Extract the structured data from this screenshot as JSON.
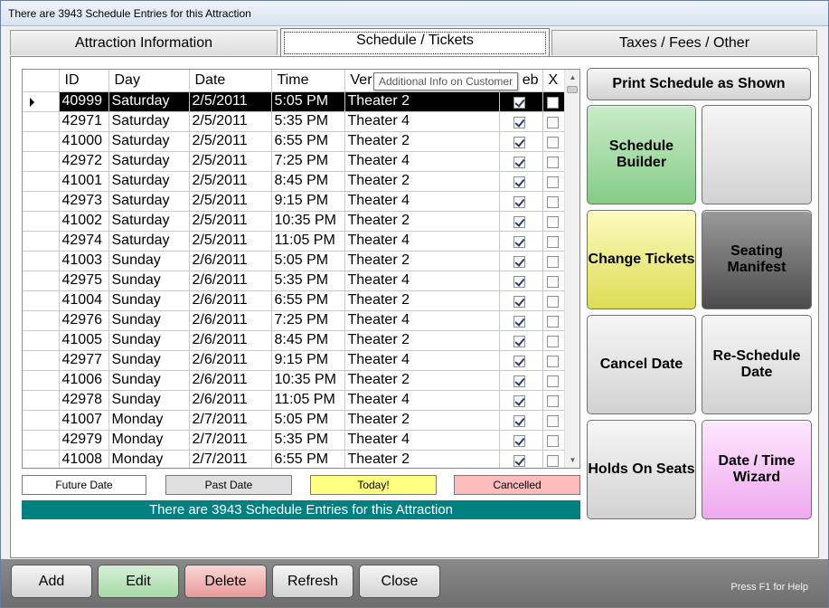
{
  "window": {
    "title": "There are 3943 Schedule Entries for this Attraction"
  },
  "tabs": [
    {
      "label": "Attraction Information"
    },
    {
      "label": "Schedule / Tickets"
    },
    {
      "label": "Taxes / Fees / Other"
    }
  ],
  "grid": {
    "columns": [
      "ID",
      "Day",
      "Date",
      "Time",
      "Ver",
      "eb",
      "X"
    ],
    "rows": [
      {
        "id": "40999",
        "day": "Saturday",
        "date": "2/5/2011",
        "time": "5:05 PM",
        "venue": "Theater 2",
        "web": true,
        "x": false
      },
      {
        "id": "42971",
        "day": "Saturday",
        "date": "2/5/2011",
        "time": "5:35 PM",
        "venue": "Theater 4",
        "web": true,
        "x": false
      },
      {
        "id": "41000",
        "day": "Saturday",
        "date": "2/5/2011",
        "time": "6:55 PM",
        "venue": "Theater 2",
        "web": true,
        "x": false
      },
      {
        "id": "42972",
        "day": "Saturday",
        "date": "2/5/2011",
        "time": "7:25 PM",
        "venue": "Theater 4",
        "web": true,
        "x": false
      },
      {
        "id": "41001",
        "day": "Saturday",
        "date": "2/5/2011",
        "time": "8:45 PM",
        "venue": "Theater 2",
        "web": true,
        "x": false
      },
      {
        "id": "42973",
        "day": "Saturday",
        "date": "2/5/2011",
        "time": "9:15 PM",
        "venue": "Theater 4",
        "web": true,
        "x": false
      },
      {
        "id": "41002",
        "day": "Saturday",
        "date": "2/5/2011",
        "time": "10:35 PM",
        "venue": "Theater 2",
        "web": true,
        "x": false
      },
      {
        "id": "42974",
        "day": "Saturday",
        "date": "2/5/2011",
        "time": "11:05 PM",
        "venue": "Theater 4",
        "web": true,
        "x": false
      },
      {
        "id": "41003",
        "day": "Sunday",
        "date": "2/6/2011",
        "time": "5:05 PM",
        "venue": "Theater 2",
        "web": true,
        "x": false
      },
      {
        "id": "42975",
        "day": "Sunday",
        "date": "2/6/2011",
        "time": "5:35 PM",
        "venue": "Theater 4",
        "web": true,
        "x": false
      },
      {
        "id": "41004",
        "day": "Sunday",
        "date": "2/6/2011",
        "time": "6:55 PM",
        "venue": "Theater 2",
        "web": true,
        "x": false
      },
      {
        "id": "42976",
        "day": "Sunday",
        "date": "2/6/2011",
        "time": "7:25 PM",
        "venue": "Theater 4",
        "web": true,
        "x": false
      },
      {
        "id": "41005",
        "day": "Sunday",
        "date": "2/6/2011",
        "time": "8:45 PM",
        "venue": "Theater 2",
        "web": true,
        "x": false
      },
      {
        "id": "42977",
        "day": "Sunday",
        "date": "2/6/2011",
        "time": "9:15 PM",
        "venue": "Theater 4",
        "web": true,
        "x": false
      },
      {
        "id": "41006",
        "day": "Sunday",
        "date": "2/6/2011",
        "time": "10:35 PM",
        "venue": "Theater 2",
        "web": true,
        "x": false
      },
      {
        "id": "42978",
        "day": "Sunday",
        "date": "2/6/2011",
        "time": "11:05 PM",
        "venue": "Theater 4",
        "web": true,
        "x": false
      },
      {
        "id": "41007",
        "day": "Monday",
        "date": "2/7/2011",
        "time": "5:05 PM",
        "venue": "Theater 2",
        "web": true,
        "x": false
      },
      {
        "id": "42979",
        "day": "Monday",
        "date": "2/7/2011",
        "time": "5:35 PM",
        "venue": "Theater 4",
        "web": true,
        "x": false
      },
      {
        "id": "41008",
        "day": "Monday",
        "date": "2/7/2011",
        "time": "6:55 PM",
        "venue": "Theater 2",
        "web": true,
        "x": false
      }
    ],
    "tooltip": "Additional Info on Customer"
  },
  "legend": {
    "future": "Future Date",
    "past": "Past Date",
    "today": "Today!",
    "cancelled": "Cancelled"
  },
  "status": "There are 3943 Schedule Entries for this Attraction",
  "actions": {
    "print": "Print Schedule as Shown",
    "schedule_builder": "Schedule Builder",
    "change_tickets": "Change Tickets",
    "seating_manifest": "Seating Manifest",
    "cancel_date": "Cancel Date",
    "reschedule_date": "Re-Schedule Date",
    "holds_on_seats": "Holds On Seats",
    "date_time_wizard": "Date / Time Wizard"
  },
  "bottom": {
    "add": "Add",
    "edit": "Edit",
    "delete": "Delete",
    "refresh": "Refresh",
    "close": "Close",
    "help": "Press F1 for Help"
  },
  "colors": {
    "status_bar": "#008080",
    "today": "#ffff80",
    "cancelled": "#ffbcbc",
    "past": "#e0e0e0"
  },
  "icons": [
    "row-pointer-icon",
    "checkbox-icon",
    "scroll-up-icon",
    "scroll-down-icon"
  ]
}
